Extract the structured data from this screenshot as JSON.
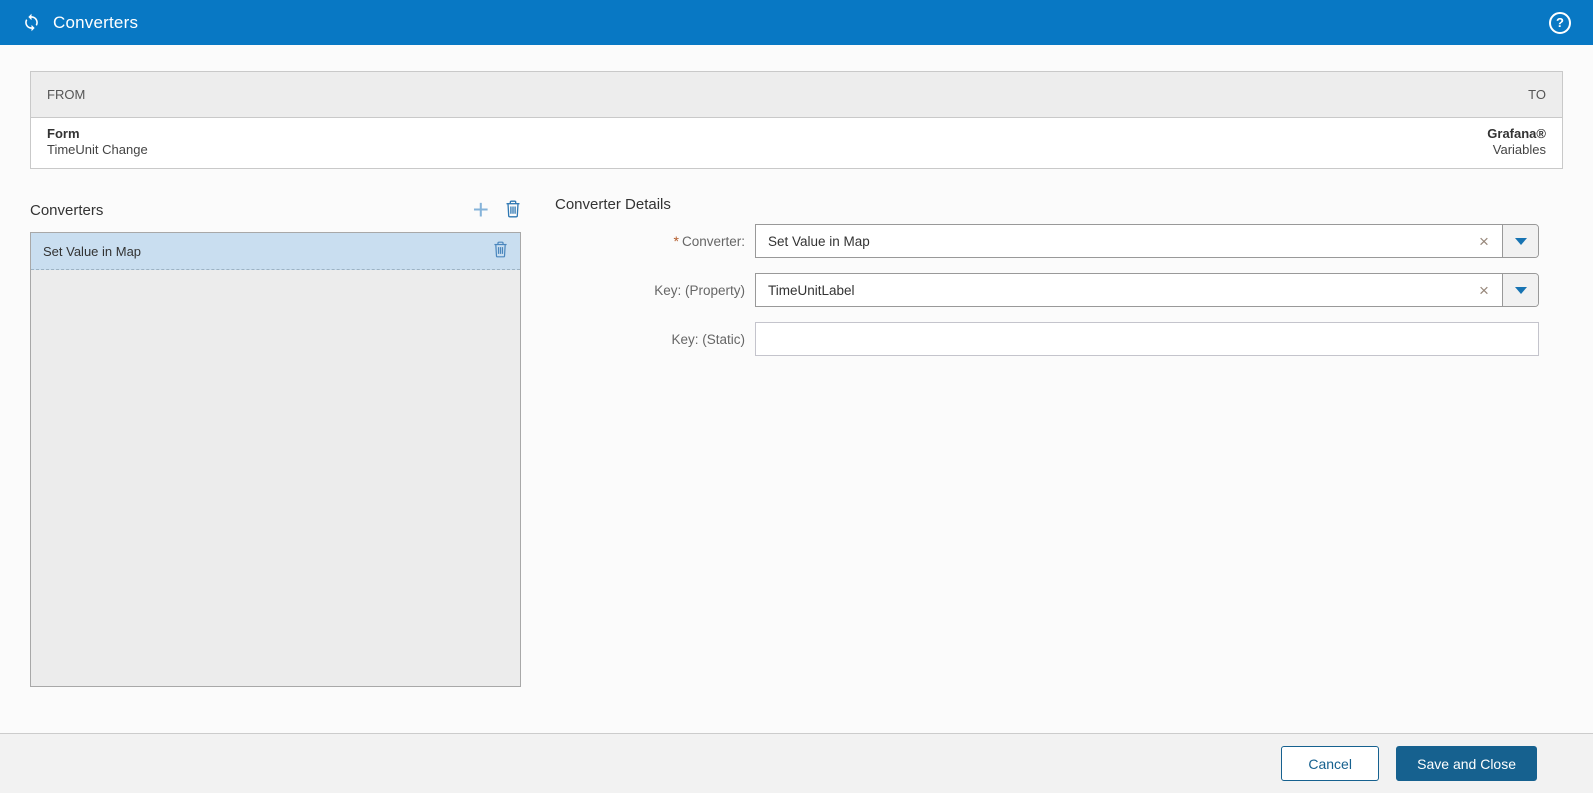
{
  "header": {
    "title": "Converters",
    "help_glyph": "?"
  },
  "mapping_table": {
    "from_header": "FROM",
    "to_header": "TO",
    "row": {
      "from_primary": "Form",
      "from_secondary": "TimeUnit Change",
      "to_primary": "Grafana®",
      "to_secondary": "Variables"
    }
  },
  "converters_panel": {
    "title": "Converters",
    "add_glyph": "+",
    "items": [
      {
        "label": "Set Value in Map",
        "selected": true
      }
    ]
  },
  "details_panel": {
    "title": "Converter Details",
    "required_marker": "*",
    "clear_glyph": "×",
    "fields": [
      {
        "label": "Converter:",
        "required": true,
        "type": "combo",
        "value": "Set Value in Map"
      },
      {
        "label": "Key: (Property)",
        "required": false,
        "type": "combo",
        "value": "TimeUnitLabel"
      },
      {
        "label": "Key: (Static)",
        "required": false,
        "type": "text",
        "value": ""
      }
    ]
  },
  "footer": {
    "cancel_label": "Cancel",
    "save_label": "Save and Close"
  },
  "colors": {
    "header_blue": "#0878c4",
    "button_blue": "#16618f",
    "selected_item_bg": "#c9def0",
    "list_bg": "#ececec",
    "required_asterisk": "#b35b2a"
  }
}
